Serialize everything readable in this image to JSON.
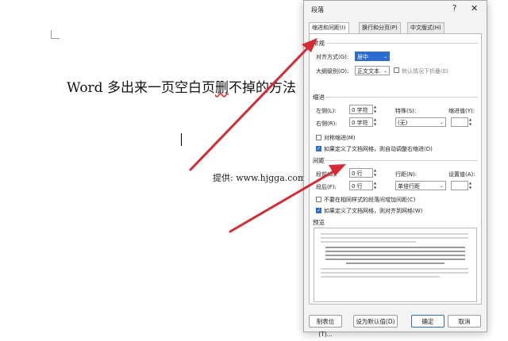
{
  "document": {
    "title_before": "Word 多出来一页空白页",
    "title_underlined": "删",
    "title_after": "不掉的方法",
    "credit": "提供: www.hjgga.com"
  },
  "dialog": {
    "title": "段落",
    "help": "?",
    "close": "✕",
    "tabs": [
      "缩进和间距(I)",
      "换行和分页(P)",
      "中文版式(H)"
    ],
    "general": {
      "heading": "常规",
      "align_label": "对齐方式(G):",
      "align_value": "居中",
      "outline_label": "大纲级别(O):",
      "outline_value": "正文文本",
      "collapse_label": "默认情况下折叠(E)"
    },
    "indent": {
      "heading": "缩进",
      "left_label": "左侧(L):",
      "left_value": "0 字符",
      "right_label": "右侧(R):",
      "right_value": "0 字符",
      "special_label": "特殊(S):",
      "special_value": "(无)",
      "indent_by_label": "缩进值(Y):",
      "mirror_label": "对称缩进(M)",
      "auto_adjust_label": "如果定义了文档网格，则自动调整右缩进(D)"
    },
    "spacing": {
      "heading": "间距",
      "before_label": "段前(B):",
      "before_value": "0 行",
      "after_label": "段后(F):",
      "after_value": "0 行",
      "line_label": "行距(N):",
      "line_value": "单倍行距",
      "at_label": "设置值(A):",
      "no_space_label": "不要在相同样式的段落间增加间距(C)",
      "snap_grid_label": "如果定义了文档网格，则对齐到网格(W)"
    },
    "preview": {
      "heading": "预览"
    },
    "buttons": {
      "tabs": "制表位(T)...",
      "default": "设为默认值(D)",
      "ok": "确定",
      "cancel": "取消"
    }
  },
  "colors": {
    "accent": "#2b6cd4",
    "arrow": "#d62b35"
  },
  "icons": {
    "dropdown": "chevron-down-icon",
    "spin": "spin-arrows-icon",
    "check": "check-icon"
  }
}
